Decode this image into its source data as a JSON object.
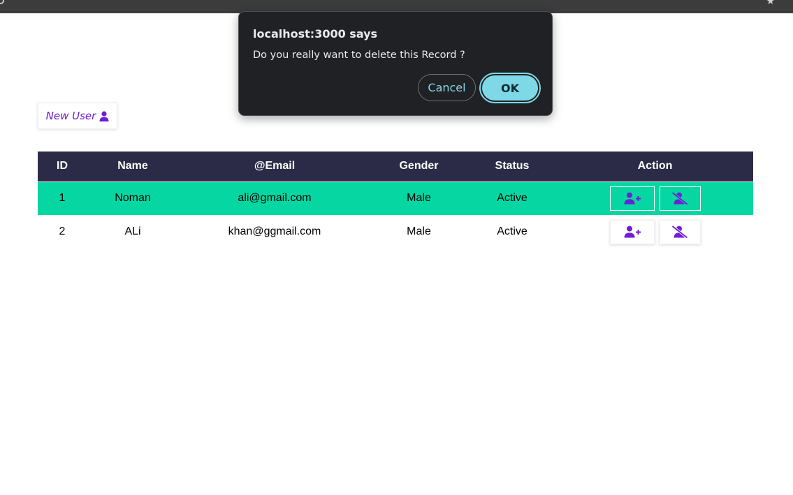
{
  "browser": {
    "star_icon": "star-icon"
  },
  "toolbar": {
    "new_user_label": "New User",
    "new_user_icon": "user-icon"
  },
  "table": {
    "headers": [
      "ID",
      "Name",
      "@Email",
      "Gender",
      "Status",
      "Action"
    ],
    "rows": [
      {
        "id": "1",
        "name": "Noman",
        "email": "ali@gmail.com",
        "gender": "Male",
        "status": "Active"
      },
      {
        "id": "2",
        "name": "ALi",
        "email": "khan@ggmail.com",
        "gender": "Male",
        "status": "Active"
      }
    ],
    "row_action_icons": [
      "user-plus-icon",
      "user-slash-icon"
    ]
  },
  "dialog": {
    "title": "localhost:3000 says",
    "message": "Do you really want to delete this Record ?",
    "cancel_label": "Cancel",
    "ok_label": "OK"
  },
  "colors": {
    "header_bg": "#2c2b47",
    "highlight_row": "#05d6a2",
    "accent_purple": "#6e1ed6",
    "dialog_bg": "#1f2124",
    "ok_button": "#7fd8e6"
  }
}
